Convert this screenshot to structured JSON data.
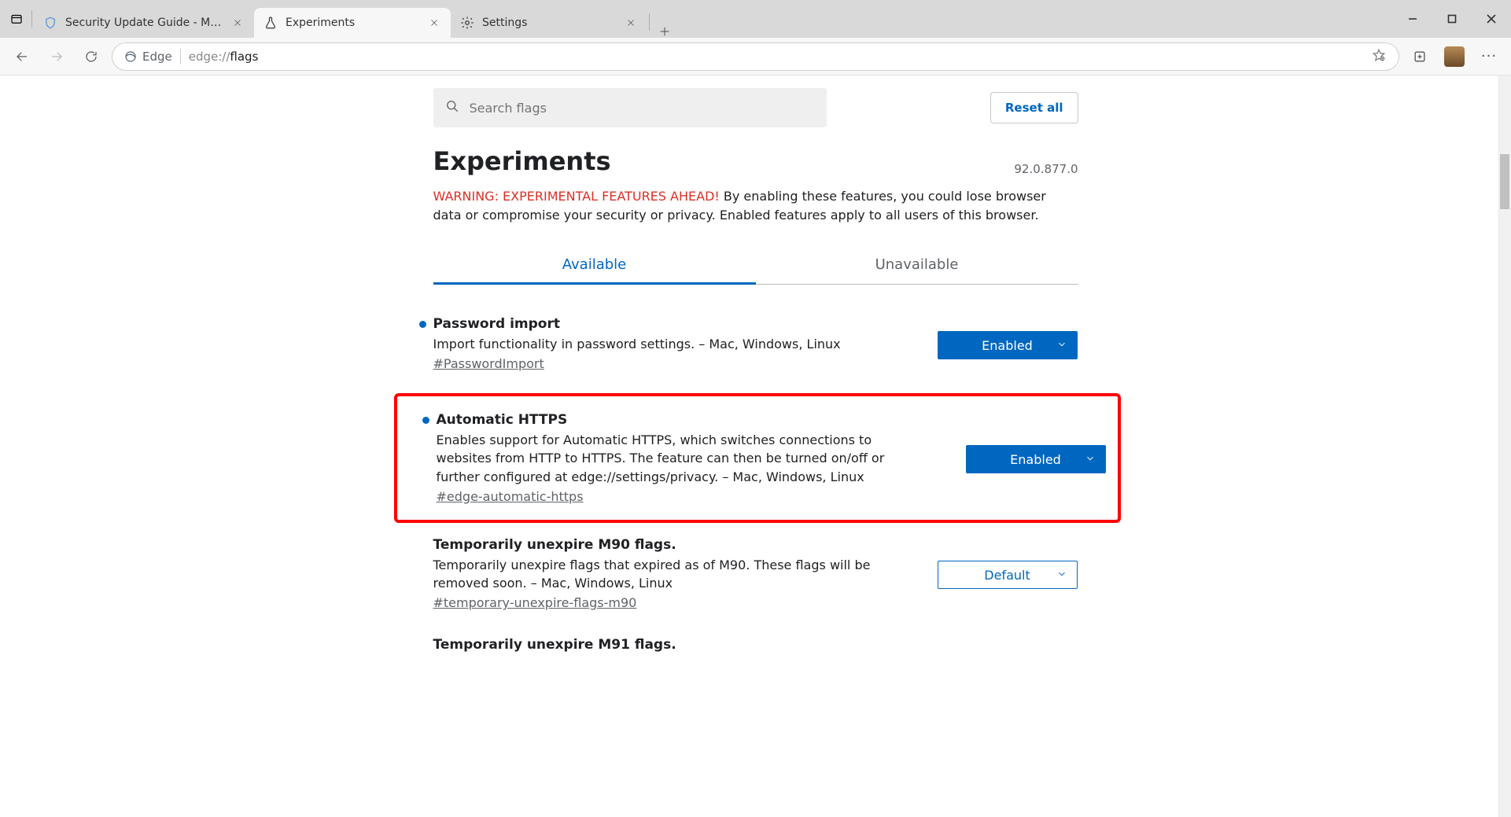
{
  "window": {
    "tabs": [
      {
        "label": "Security Update Guide - Microso",
        "active": false,
        "icon": "shield"
      },
      {
        "label": "Experiments",
        "active": true,
        "icon": "flask"
      },
      {
        "label": "Settings",
        "active": false,
        "icon": "gear"
      }
    ]
  },
  "toolbar": {
    "site_identity": "Edge",
    "url_prefix": "edge://",
    "url_path": "flags"
  },
  "search": {
    "placeholder": "Search flags",
    "reset_label": "Reset all"
  },
  "header": {
    "title": "Experiments",
    "version": "92.0.877.0"
  },
  "warning": {
    "label": "WARNING: EXPERIMENTAL FEATURES AHEAD!",
    "text": " By enabling these features, you could lose browser data or compromise your security or privacy. Enabled features apply to all users of this browser."
  },
  "tabs": {
    "available": "Available",
    "unavailable": "Unavailable"
  },
  "select_options": {
    "enabled": "Enabled",
    "default": "Default"
  },
  "flags": [
    {
      "title": "Password import",
      "desc": "Import functionality in password settings. – Mac, Windows, Linux",
      "hash": "#PasswordImport",
      "state": "enabled",
      "bullet": true,
      "highlight": false
    },
    {
      "title": "Automatic HTTPS",
      "desc": "Enables support for Automatic HTTPS, which switches connections to websites from HTTP to HTTPS. The feature can then be turned on/off or further configured at edge://settings/privacy. – Mac, Windows, Linux",
      "hash": "#edge-automatic-https",
      "state": "enabled",
      "bullet": true,
      "highlight": true
    },
    {
      "title": "Temporarily unexpire M90 flags.",
      "desc": "Temporarily unexpire flags that expired as of M90. These flags will be removed soon. – Mac, Windows, Linux",
      "hash": "#temporary-unexpire-flags-m90",
      "state": "default",
      "bullet": false,
      "highlight": false
    },
    {
      "title": "Temporarily unexpire M91 flags.",
      "desc": "",
      "hash": "",
      "state": "",
      "bullet": false,
      "highlight": false
    }
  ]
}
